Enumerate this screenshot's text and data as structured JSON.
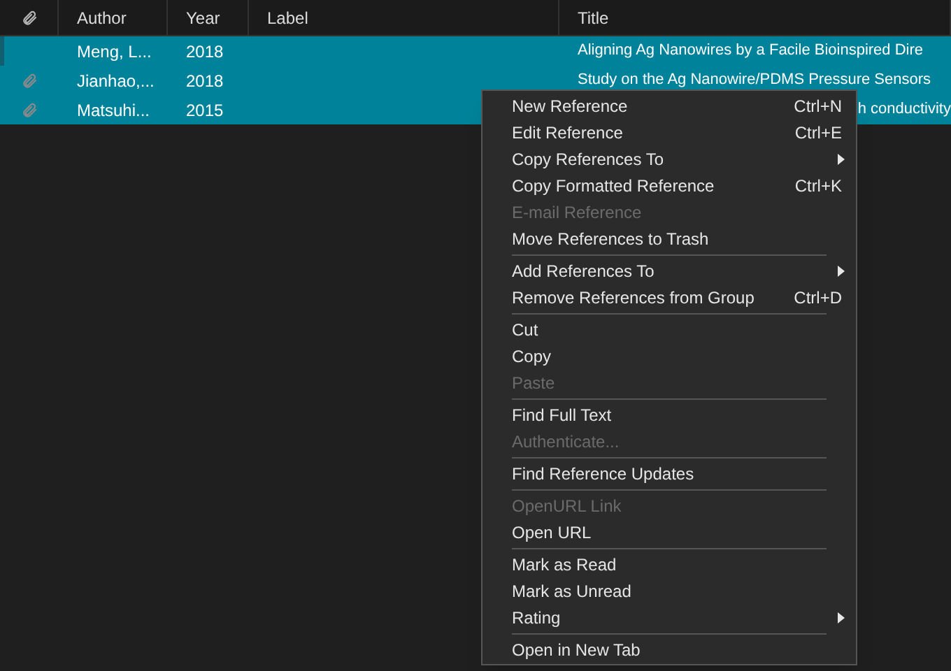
{
  "table": {
    "columns": [
      {
        "kind": "attachment"
      },
      {
        "kind": "text",
        "label": "Author"
      },
      {
        "kind": "text",
        "label": "Year"
      },
      {
        "kind": "text",
        "label": "Label"
      },
      {
        "kind": "text",
        "label": "Title"
      }
    ],
    "rows": [
      {
        "attachment": false,
        "author": "Meng, L...",
        "year": "2018",
        "label": "",
        "title": "Aligning Ag Nanowires by a Facile Bioinspired Dire",
        "title_clipped": false,
        "selected": true,
        "focused": true
      },
      {
        "attachment": true,
        "author": "Jianhao,...",
        "year": "2018",
        "title": "Study on the Ag Nanowire/PDMS Pressure Sensors",
        "title_clipped": false,
        "selected": true,
        "focused": false
      },
      {
        "attachment": true,
        "author": "Matsuhi...",
        "year": "2015",
        "title": "h conductivity",
        "title_clipped": true,
        "selected": true,
        "focused": false
      }
    ]
  },
  "context_menu": {
    "items": [
      {
        "kind": "item",
        "label": "New Reference",
        "shortcut": "Ctrl+N",
        "disabled": false,
        "submenu": false
      },
      {
        "kind": "item",
        "label": "Edit Reference",
        "shortcut": "Ctrl+E",
        "disabled": false,
        "submenu": false
      },
      {
        "kind": "item",
        "label": "Copy References To",
        "disabled": false,
        "submenu": true
      },
      {
        "kind": "item",
        "label": "Copy Formatted Reference",
        "shortcut": "Ctrl+K",
        "disabled": false,
        "submenu": false
      },
      {
        "kind": "item",
        "label": "E-mail Reference",
        "disabled": true,
        "submenu": false
      },
      {
        "kind": "item",
        "label": "Move References to Trash",
        "disabled": false,
        "submenu": false
      },
      {
        "kind": "separator"
      },
      {
        "kind": "item",
        "label": "Add References To",
        "disabled": false,
        "submenu": true
      },
      {
        "kind": "item",
        "label": "Remove References from Group",
        "shortcut": "Ctrl+D",
        "disabled": false,
        "submenu": false
      },
      {
        "kind": "separator"
      },
      {
        "kind": "item",
        "label": "Cut",
        "disabled": false,
        "submenu": false
      },
      {
        "kind": "item",
        "label": "Copy",
        "disabled": false,
        "submenu": false
      },
      {
        "kind": "item",
        "label": "Paste",
        "disabled": true,
        "submenu": false
      },
      {
        "kind": "separator"
      },
      {
        "kind": "item",
        "label": "Find Full Text",
        "disabled": false,
        "submenu": false
      },
      {
        "kind": "item",
        "label": "Authenticate...",
        "disabled": true,
        "submenu": false
      },
      {
        "kind": "separator"
      },
      {
        "kind": "item",
        "label": "Find Reference Updates",
        "disabled": false,
        "submenu": false
      },
      {
        "kind": "separator"
      },
      {
        "kind": "item",
        "label": "OpenURL Link",
        "disabled": true,
        "submenu": false
      },
      {
        "kind": "item",
        "label": "Open URL",
        "disabled": false,
        "submenu": false
      },
      {
        "kind": "separator"
      },
      {
        "kind": "item",
        "label": "Mark as Read",
        "disabled": false,
        "submenu": false
      },
      {
        "kind": "item",
        "label": "Mark as Unread",
        "disabled": false,
        "submenu": false
      },
      {
        "kind": "item",
        "label": "Rating",
        "disabled": false,
        "submenu": true
      },
      {
        "kind": "separator"
      },
      {
        "kind": "item",
        "label": "Open in New Tab",
        "disabled": false,
        "submenu": false
      }
    ]
  }
}
